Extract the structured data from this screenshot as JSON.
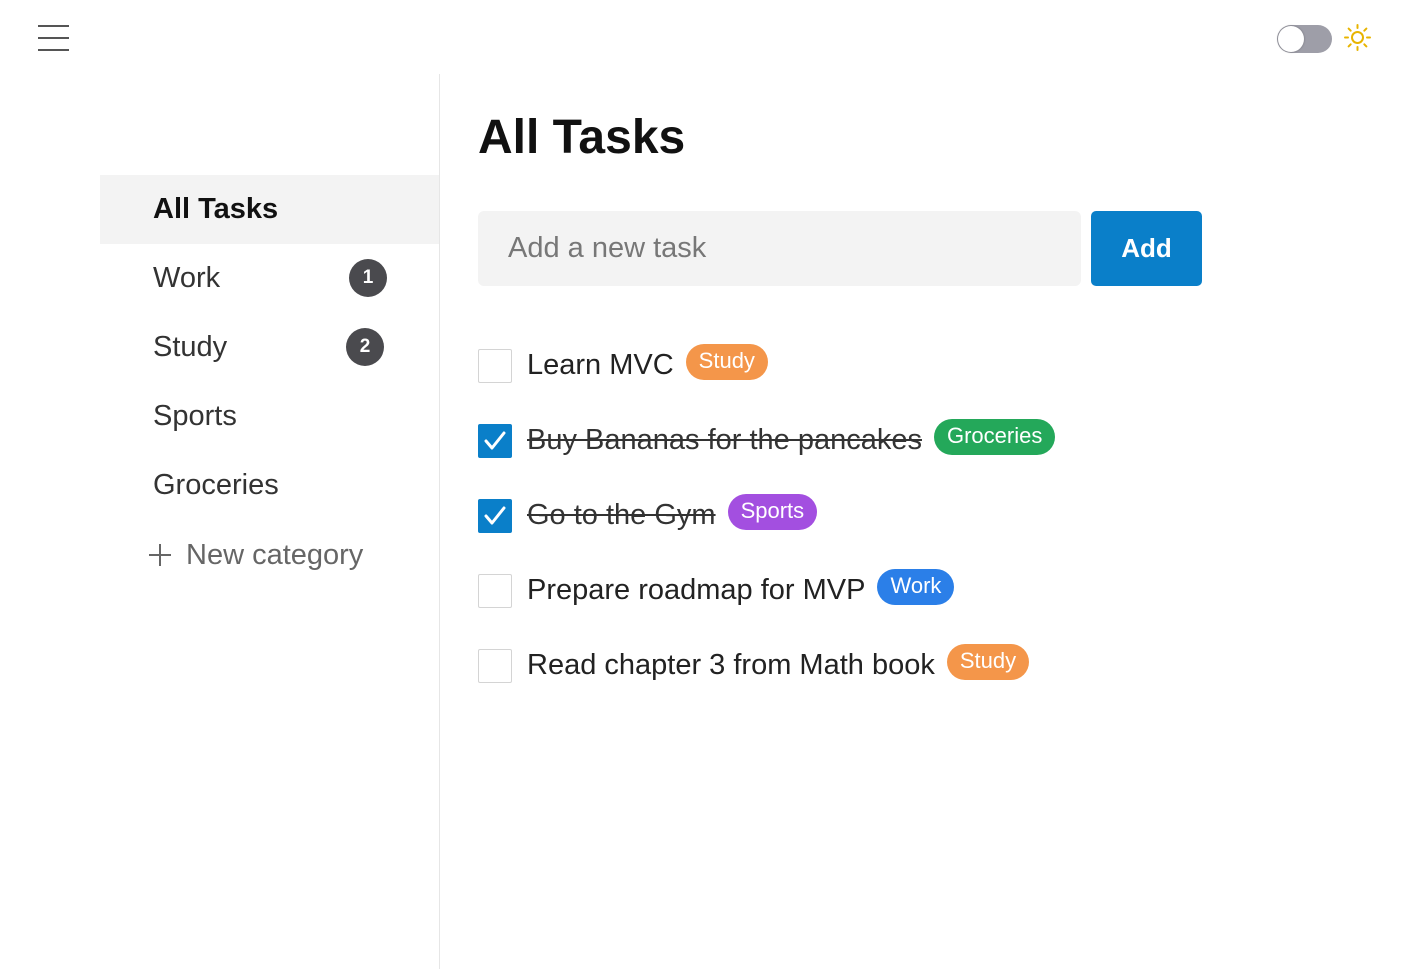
{
  "header": {
    "menu_icon": "hamburger-icon",
    "theme_toggle_on": false,
    "theme_icon": "sun-icon",
    "sun_color": "#e8b400"
  },
  "sidebar": {
    "items": [
      {
        "label": "All Tasks",
        "badge": null
      },
      {
        "label": "Work",
        "badge": "1"
      },
      {
        "label": "Study",
        "badge": "2"
      },
      {
        "label": "Sports",
        "badge": null
      },
      {
        "label": "Groceries",
        "badge": null
      }
    ],
    "new_category": {
      "icon": "plus-icon",
      "label": "New category"
    }
  },
  "main": {
    "title": "All Tasks",
    "input_placeholder": "Add a new task",
    "add_label": "Add",
    "tasks": [
      {
        "text": "Learn MVC",
        "done": false,
        "tag": "Study",
        "tag_color": "#f4964a"
      },
      {
        "text": "Buy Bananas for the pancakes",
        "done": true,
        "tag": "Groceries",
        "tag_color": "#24a85a"
      },
      {
        "text": "Go to the Gym",
        "done": true,
        "tag": "Sports",
        "tag_color": "#a34fe0"
      },
      {
        "text": "Prepare roadmap for MVP",
        "done": false,
        "tag": "Work",
        "tag_color": "#2b7fe8"
      },
      {
        "text": "Read chapter 3 from Math book",
        "done": false,
        "tag": "Study",
        "tag_color": "#f4964a"
      }
    ]
  },
  "colors": {
    "accent": "#0a7fc9",
    "badge_bg": "#4a4a4e"
  }
}
